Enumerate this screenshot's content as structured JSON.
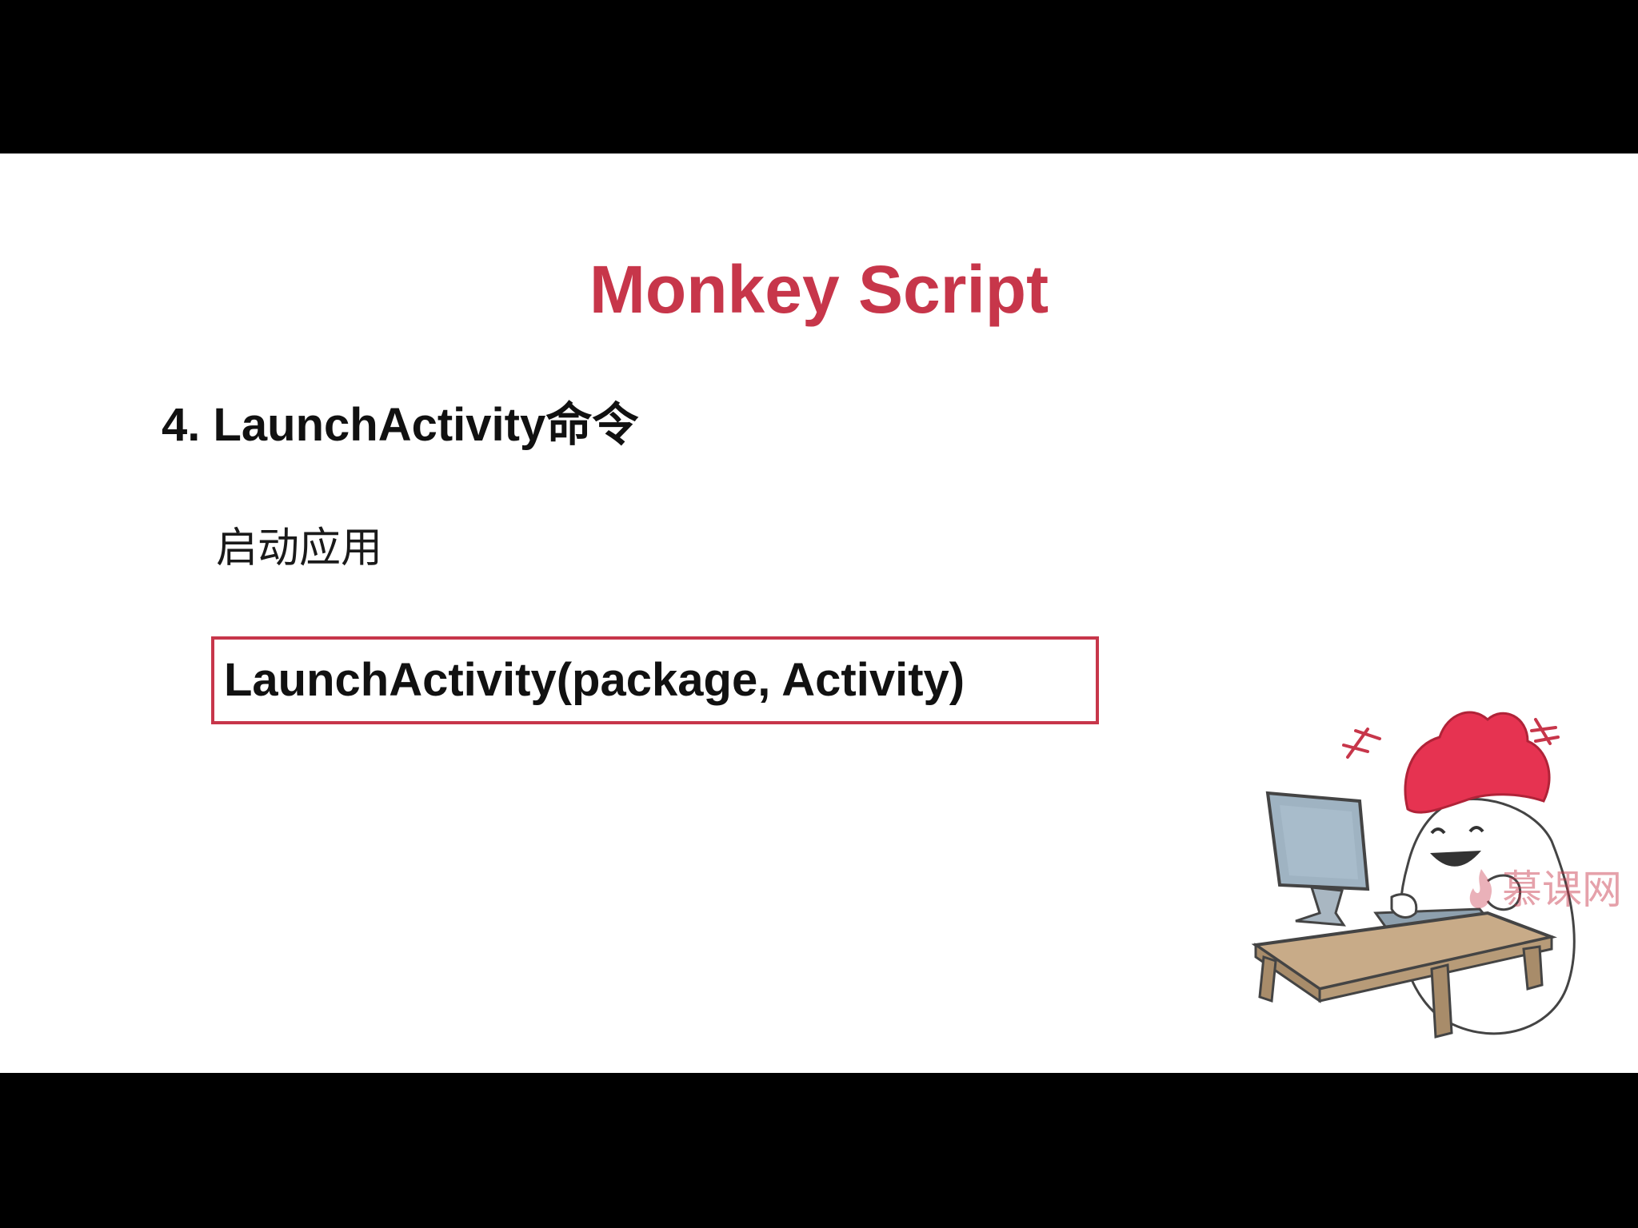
{
  "slide": {
    "title": "Monkey Script",
    "heading": "4. LaunchActivity命令",
    "description": "启动应用",
    "code": "LaunchActivity(package, Activity)"
  },
  "watermark": {
    "text": "慕课网",
    "icon": "flame-logo-icon"
  },
  "illustration": {
    "icon": "mascot-at-computer-icon"
  },
  "colors": {
    "accent": "#c7364a",
    "text": "#111111",
    "background": "#ffffff",
    "letterbox": "#000000"
  }
}
